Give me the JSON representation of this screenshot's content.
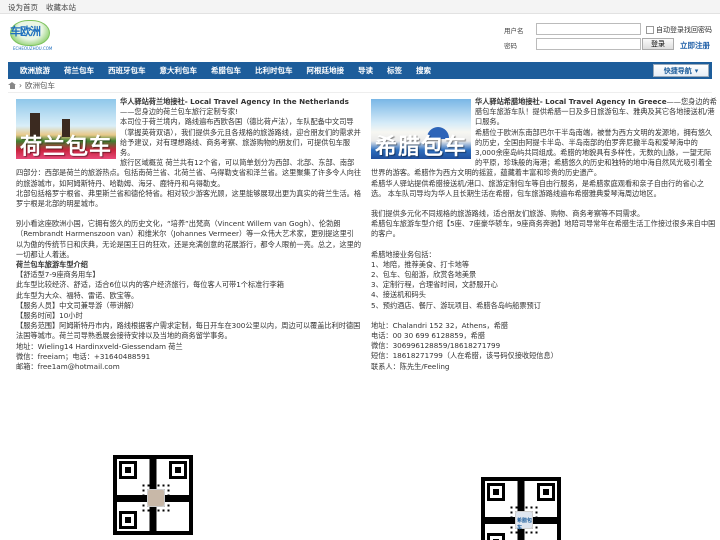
{
  "topbar": {
    "links": [
      "设为首页",
      "收藏本站"
    ]
  },
  "logo": {
    "text": "车欧洲",
    "tagline": "ECHEOUZHOU.COM"
  },
  "login": {
    "username_label": "用户名",
    "password_label": "密码",
    "remember_label": "自动登录",
    "forgot_label": "找回密码",
    "login_button": "登录",
    "register_label": "立即注册"
  },
  "nav": {
    "items": [
      "欧洲旅游",
      "荷兰包车",
      "西班牙包车",
      "意大利包车",
      "希腊包车",
      "比利时包车",
      "阿根廷地接",
      "导读",
      "标签",
      "搜索"
    ],
    "quick_label": "快捷导航"
  },
  "breadcrumb": {
    "current": "欧洲包车"
  },
  "left": {
    "image_text": "荷兰包车",
    "title": "华人驿站荷兰地接社- Local Travel Agency In the Netherlands",
    "title_suffix": "——您身边的荷兰包车旅行定制专家!",
    "intro": "本司位于荷兰境内，路线遍布西欧各国（德比荷卢法），车队配备中文司导（掌握英荷双语），我们提供多元且各规格的旅游路线，迎合朋友们的需求并给予建议，对有理想路线、商务考察、旅游购物的朋友们，可提供包车服务。",
    "overview": "旅行区域概览 荷兰共有12个省，可以简单划分为西部、北部、东部、南部四部分：西部是荷兰的旅游热点。包括南荷兰省、北荷兰省、乌得勒支省和泽兰省。这里聚集了许多令人向往的旅游城市，如阿姆斯特丹、哈勒姆、海牙、鹿特丹和乌得勒支。",
    "overview2": "北部包括格罗宁根省、弗里斯兰省和德伦特省。相对较少游客光顾，这里能够展现出更为真实的荷兰生活。格罗宁根是北部的明星城市。",
    "history": "别小看这座欧洲小国，它拥有悠久的历史文化，“培养”出梵高（Vincent Willem van Gogh）、伦勃朗（Rembrandt Harmenszoon van）和维米尔（Johannes Vermeer）等一众伟大艺术家，更别提这里引以为傲的传统节日和庆典，无论是国王日的狂欢，还是充满创意的花展游行，都令人眼前一亮。总之，这里的一切都让人着迷。",
    "services_title": "荷兰包车旅游车型介绍",
    "services": [
      "【舒适型7-9座商务用车】",
      "此车型比较经济、舒适，适合6位以内的客户经济旅行，每位客人可带1个标准行李箱",
      "此车型为大众、福特、雷诺、欧宝等。",
      "【服务人员】中文司兼导游（带讲解）",
      "【服务时间】10小时",
      "【服务范围】阿姆斯特丹市内，路线根据客户需求定制，每日开车在300公里以内，周边可以覆盖比利时德国法国等城市。荷兰司导熟悉展会接待安排以及当地的商务留学事务。"
    ],
    "contacts": [
      "地址：Wieling14 Hardinxveld-Giessendam 荷兰",
      "微信：freeiam；电话：+31640488591",
      "邮箱：free1am@hotmail.com"
    ]
  },
  "right": {
    "image_text": "希腊包车",
    "title": "华人驿站希腊地接社- Local Travel Agency In Greece",
    "title_suffix": "——您身边的希腊包车旅游车队！提供希腊一日及多日旅游包车、雅典及其它各地接送机/港口服务。",
    "intro": "希腊位于欧洲东南部巴尔干半岛南端，被誉为西方文明的发源地，拥有悠久的历史，全国由阿提卡半岛、半岛南部的伯罗奔尼撒半岛和爱琴海中的3,000余座岛屿共同组成。希腊的地貌具有多样性，无数的山脉，一望无际的平原，珍珠般的海港；希腊悠久的历史和独特的地中海自然风光吸引着全世界的游客。希腊作为西方文明的摇篮，蕴藏着丰富和珍贵的历史遗产。",
    "intro2": "希腊华人驿站提供希腊接送机/港口、旅游定制包车等自由行服务，是希腊家庭观看和亲子自由行的省心之选。 本车队司导均为华人且长期生活在希腊，包车旅游路线遍布希腊雅典爱琴海周边地区。",
    "intro3": "我们提供多元化不同规格的旅游路线，适合朋友们旅游、购物、商务考察等不同需求。",
    "models": "希腊包车旅游车型介绍【5座、7座豪华轿车，9座商务奔驰】地陪司导常年在希腊生活工作接过很多来自中国的客户。",
    "services_title": "希腊地接业务包括：",
    "services": [
      "1、地陪，推荐美食、打卡地等",
      "2、包车、包船游，欣赏各地美景",
      "3、定制行程，合理省时间，文舒服开心",
      "4、接送机和码头",
      "5、预约酒店、餐厅、游玩项目、希腊各岛屿船票预订"
    ],
    "contacts": [
      "地址：Chalandri 152 32，Athens，希腊",
      "电话：00 30 699 6128859，希腊",
      "微信：306996128859/18618271799",
      "短信：18618271799（人在希腊，该号码仅接收短信息）",
      "联系人：陈先生/Feeling"
    ]
  },
  "colors": {
    "nav_bg": "#1d5d9b",
    "accent": "#1e5fa8"
  }
}
